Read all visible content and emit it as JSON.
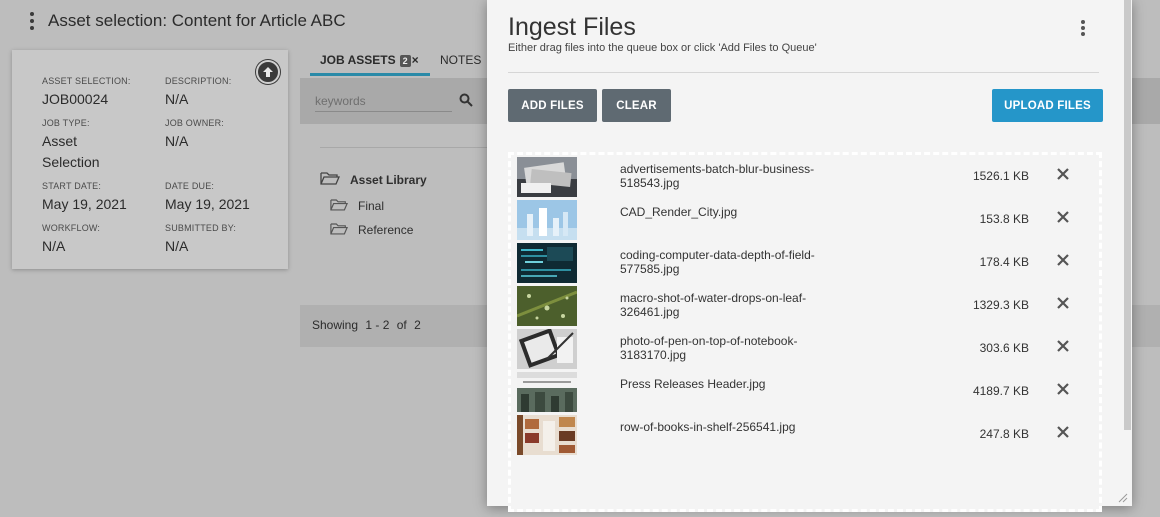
{
  "page": {
    "title": "Asset selection: Content for Article ABC"
  },
  "info_card": {
    "fields": [
      {
        "label": "ASSET SELECTION:",
        "value": "JOB00024"
      },
      {
        "label": "DESCRIPTION:",
        "value": "N/A"
      },
      {
        "label": "JOB TYPE:",
        "value": "Asset Selection"
      },
      {
        "label": "JOB OWNER:",
        "value": "N/A"
      },
      {
        "label": "START DATE:",
        "value": "May 19, 2021"
      },
      {
        "label": "DATE DUE:",
        "value": "May 19, 2021"
      },
      {
        "label": "WORKFLOW:",
        "value": "N/A"
      },
      {
        "label": "SUBMITTED BY:",
        "value": "N/A"
      }
    ]
  },
  "tabs": {
    "assets_label": "JOB ASSETS",
    "assets_count": "2",
    "assets_close": "×",
    "notes_label": "NOTES"
  },
  "search": {
    "placeholder": "keywords"
  },
  "tree": {
    "root": "Asset Library",
    "children": [
      "Final",
      "Reference"
    ]
  },
  "pagination": {
    "showing": "Showing",
    "range": "1 - 2",
    "of": "of",
    "total": "2"
  },
  "modal": {
    "title": "Ingest Files",
    "subtitle": "Either drag files into the queue box or click 'Add Files to Queue'",
    "add_label": "ADD FILES",
    "clear_label": "CLEAR",
    "upload_label": "UPLOAD FILES",
    "files": [
      {
        "name": "advertisements-batch-blur-business-518543.jpg",
        "size": "1526.1 KB",
        "thumb": "newspapers"
      },
      {
        "name": "CAD_Render_City.jpg",
        "size": "153.8 KB",
        "thumb": "city-render"
      },
      {
        "name": "coding-computer-data-depth-of-field-577585.jpg",
        "size": "178.4 KB",
        "thumb": "code-screen"
      },
      {
        "name": "macro-shot-of-water-drops-on-leaf-326461.jpg",
        "size": "1329.3 KB",
        "thumb": "leaf"
      },
      {
        "name": "photo-of-pen-on-top-of-notebook-3183170.jpg",
        "size": "303.6 KB",
        "thumb": "notebook"
      },
      {
        "name": "Press Releases Header.jpg",
        "size": "4189.7 KB",
        "thumb": "header"
      },
      {
        "name": "row-of-books-in-shelf-256541.jpg",
        "size": "247.8 KB",
        "thumb": "books"
      }
    ]
  },
  "colors": {
    "accent": "#2596c9",
    "tab_underline": "#2a8aa8",
    "secondary_button": "#5f6a72"
  }
}
